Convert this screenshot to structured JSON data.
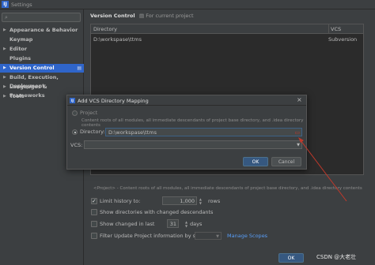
{
  "window": {
    "icon_letter": "IJ",
    "title": "Settings"
  },
  "sidebar": {
    "items": [
      {
        "label": "Appearance & Behavior",
        "expandable": true
      },
      {
        "label": "Keymap",
        "expandable": false
      },
      {
        "label": "Editor",
        "expandable": true
      },
      {
        "label": "Plugins",
        "expandable": false
      },
      {
        "label": "Version Control",
        "expandable": true,
        "active": true
      },
      {
        "label": "Build, Execution, Deployment",
        "expandable": true
      },
      {
        "label": "Languages & Frameworks",
        "expandable": true
      },
      {
        "label": "Tools",
        "expandable": true
      }
    ]
  },
  "main": {
    "breadcrumb": "Version Control",
    "scope": "For current project",
    "table": {
      "columns": [
        "Directory",
        "VCS"
      ],
      "rows": [
        {
          "directory": "D:\\workspase\\ttms",
          "vcs": "Subversion"
        }
      ]
    },
    "hint": "<Project> - Content roots of all modules, all immediate descendants of project base directory, and .idea directory contents",
    "options": {
      "limit_history_label": "Limit history to:",
      "limit_history_value": "1,000",
      "limit_history_unit": "rows",
      "show_dirs_label": "Show directories with changed descendants",
      "show_changed_label": "Show changed in last",
      "show_changed_value": "31",
      "show_changed_unit": "days",
      "filter_label": "Filter Update Project information by scope",
      "manage_scopes": "Manage Scopes"
    },
    "ok_label": "OK"
  },
  "dialog": {
    "title": "Add VCS Directory Mapping",
    "project_label": "Project",
    "project_desc": "Content roots of all modules, all immediate descendants of project base directory, and .idea directory contents",
    "directory_label": "Directory:",
    "directory_value": "D:\\workspase\\ttms",
    "vcs_label": "VCS:",
    "vcs_value": "",
    "ok_label": "OK",
    "cancel_label": "Cancel"
  },
  "watermark": "CSDN @大老壮",
  "colors": {
    "accent": "#2f65ca",
    "link": "#589df6",
    "annotation_arrow": "#c0392b"
  }
}
